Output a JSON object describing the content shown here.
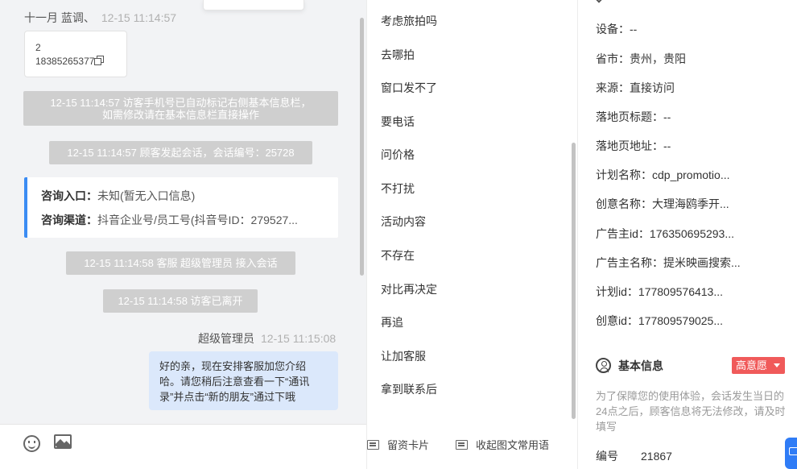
{
  "chat": {
    "visitor_msg": {
      "sender": "十一月 蓝调、",
      "time": "12-15 11:14:57",
      "phone_line1": "2",
      "phone_line2": "18385265377"
    },
    "system": [
      {
        "line1": "12-15 11:14:57 访客手机号已自动标记右侧基本信息栏，",
        "line2": "如需修改请在基本信息栏直接操作"
      },
      {
        "text": "12-15 11:14:57 顾客发起会话，会话编号：25728"
      },
      {
        "text": "12-15 11:14:58 客服 超级管理员 接入会话"
      },
      {
        "text": "12-15 11:14:58 访客已离开"
      }
    ],
    "consult": {
      "entry_label": "咨询入口：",
      "entry_value": "未知(暂无入口信息)",
      "channel_label": "咨询渠道：",
      "channel_value": "抖音企业号/员工号(抖音号ID：279527..."
    },
    "agent_msg": {
      "sender": "超级管理员",
      "time": "12-15 11:15:08",
      "line1": "好的亲，现在安排客服加您介绍",
      "line2": "哈。请您稍后注意查看一下“通讯",
      "line3": "录”并点击“新的朋友”通过下哦"
    }
  },
  "footer": {
    "emoji_icon": "smile-icon",
    "image_icon": "image-icon"
  },
  "quick_replies": [
    "考虑旅拍吗",
    "去哪拍",
    "窗口发不了",
    "要电话",
    "问价格",
    "不打扰",
    "活动内容",
    "不存在",
    "对比再决定",
    "再追",
    "让加客服",
    "拿到联系后"
  ],
  "quick_footer": {
    "card": "留资卡片",
    "collapse": "收起图文常用语"
  },
  "info": {
    "fields": [
      {
        "label": "设备：",
        "value": "--"
      },
      {
        "label": "省市：",
        "value": "贵州，贵阳"
      },
      {
        "label": "来源：",
        "value": "直接访问"
      },
      {
        "label": "落地页标题：",
        "value": "--"
      },
      {
        "label": "落地页地址：",
        "value": "--"
      },
      {
        "label": "计划名称：",
        "value": "cdp_promotio..."
      },
      {
        "label": "创意名称：",
        "value": "大理海鸥季开..."
      },
      {
        "label": "广告主id：",
        "value": "176350695293..."
      },
      {
        "label": "广告主名称：",
        "value": "提米映画搜索..."
      },
      {
        "label": "计划id：",
        "value": "177809576413..."
      },
      {
        "label": "创意id：",
        "value": "177809579025..."
      }
    ],
    "basic_title": "基本信息",
    "intent": "高意愿",
    "intent_color": "#f05a5a",
    "hint": "为了保障您的使用体验，会话发生当日的24点之后，顾客信息将无法修改，请及时填写",
    "number_label": "编号",
    "number_value": "21867"
  },
  "colors": {
    "accent": "#3b8cf3",
    "agent_bubble": "#dbe8fb",
    "system_pill": "#cfcfcf"
  }
}
